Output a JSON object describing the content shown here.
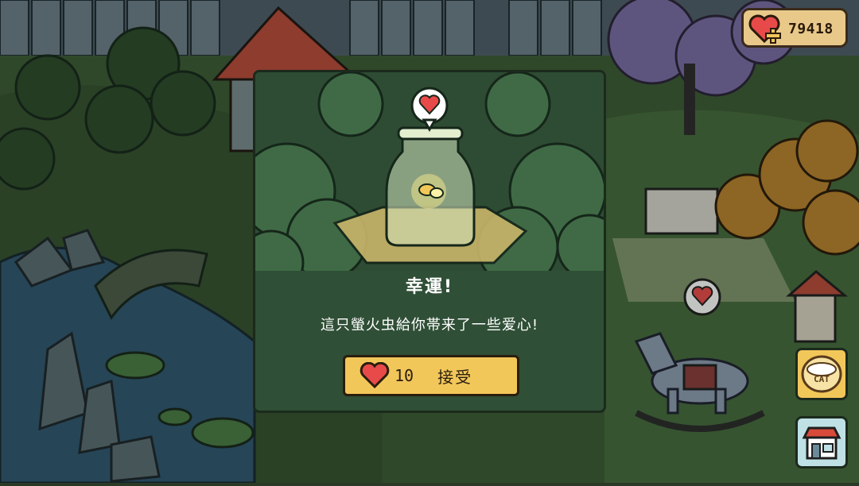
{
  "hud": {
    "hearts_amount": "79418"
  },
  "dialog": {
    "title": "幸運!",
    "message": "這只螢火虫給你帯来了一些爱心!",
    "accept": {
      "cost": "10",
      "label": "接受"
    }
  },
  "side_buttons": {
    "cat_label": "CAT"
  },
  "icons": {
    "currency": "heart-plus-icon",
    "bubble": "heart-bubble-icon",
    "button": "heart-icon",
    "cat": "cat-bowl-icon",
    "shop": "shop-icon"
  },
  "colors": {
    "heart": "#e84a4a",
    "button_bg": "#f2c75a",
    "dialog_bg": "#2f4f36",
    "currency_bg": "#e9c98a"
  }
}
